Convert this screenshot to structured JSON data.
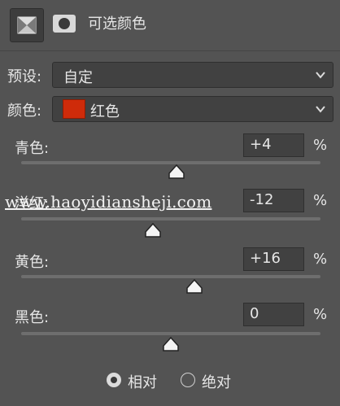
{
  "header": {
    "title": "可选颜色",
    "adjustment_icon": "selective-color-icon",
    "mask_icon": "mask-icon"
  },
  "preset": {
    "label": "预设:",
    "value": "自定"
  },
  "colors": {
    "label": "颜色:",
    "value": "红色",
    "swatch_color": "#cf2b0a"
  },
  "sliders": [
    {
      "label": "青色:",
      "value": "+4",
      "unit": "%",
      "numeric": 4
    },
    {
      "label": "洋红:",
      "value": "-12",
      "unit": "%",
      "numeric": -12
    },
    {
      "label": "黄色:",
      "value": "+16",
      "unit": "%",
      "numeric": 16
    },
    {
      "label": "黑色:",
      "value": "0",
      "unit": "%",
      "numeric": 0
    }
  ],
  "watermark": "www.haoyidiansheji.com",
  "method": {
    "options": [
      "相对",
      "绝对"
    ],
    "selected": "相对"
  }
}
